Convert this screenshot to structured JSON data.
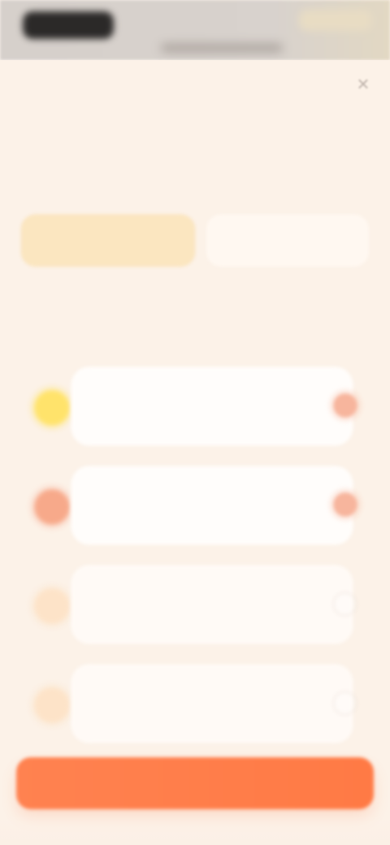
{
  "status_bar": {
    "time": "",
    "indicators": ""
  },
  "sheet": {
    "close_label": "×",
    "headline": "",
    "subheadline": "",
    "segments": [
      {
        "label": ""
      },
      {
        "label": ""
      }
    ],
    "description": "",
    "options": [
      {
        "label": "",
        "icon": "sun-icon"
      },
      {
        "label": "",
        "icon": "orange-icon"
      },
      {
        "label": "",
        "icon": "peach-icon"
      },
      {
        "label": "",
        "icon": "peach-icon"
      }
    ],
    "cta_label": ""
  },
  "colors": {
    "background": "#fcf2e8",
    "accent": "#ff7a45",
    "selected_segment": "#fbe6c0",
    "check_selected": "#f7b59d"
  }
}
